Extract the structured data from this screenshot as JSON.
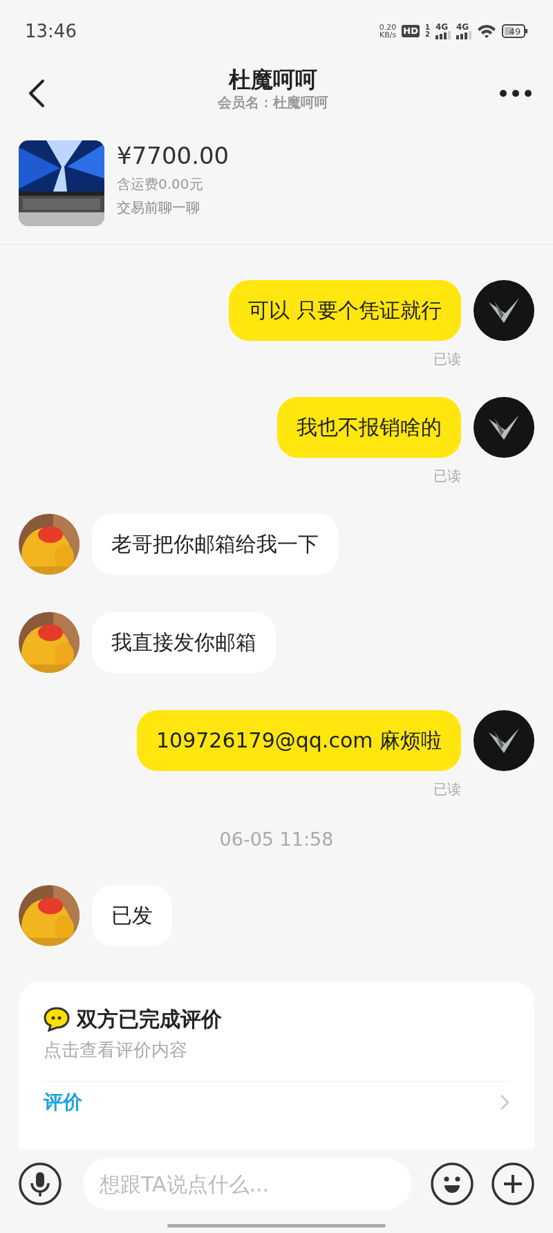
{
  "status_bar": {
    "time": "13:46",
    "net_speed": "0.20",
    "net_unit": "KB/s",
    "hd": "HD",
    "sim_1": "1",
    "sim_2": "2",
    "network_1": "4G",
    "network_2": "4G",
    "battery": "49"
  },
  "header": {
    "title": "杜魔呵呵",
    "subtitle": "会员名：杜魔呵呵"
  },
  "product": {
    "price": "¥7700.00",
    "shipping": "含运费0.00元",
    "note": "交易前聊一聊"
  },
  "messages": [
    {
      "kind": "sent",
      "text": "可以 只要个凭证就行",
      "status": "已读"
    },
    {
      "kind": "sent",
      "text": "我也不报销啥的",
      "status": "已读"
    },
    {
      "kind": "received",
      "text": "老哥把你邮箱给我一下"
    },
    {
      "kind": "received",
      "text": "我直接发你邮箱"
    },
    {
      "kind": "sent",
      "text": "109726179@qq.com 麻烦啦",
      "status": "已读"
    },
    {
      "kind": "time",
      "text": "06-05 11:58"
    },
    {
      "kind": "received",
      "text": "已发"
    }
  ],
  "review_card": {
    "title": "双方已完成评价",
    "subtitle": "点击查看评价内容",
    "link": "评价"
  },
  "input": {
    "placeholder": "想跟TA说点什么..."
  }
}
